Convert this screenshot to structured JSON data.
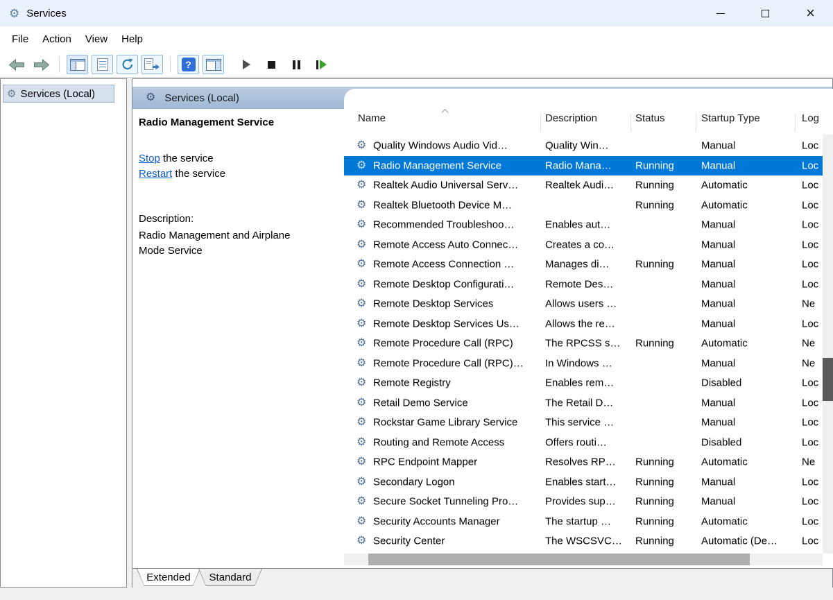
{
  "window": {
    "title": "Services"
  },
  "menu": {
    "items": [
      "File",
      "Action",
      "View",
      "Help"
    ]
  },
  "toolbar": {
    "buttons": [
      "back",
      "forward",
      "show-console-tree",
      "properties",
      "refresh",
      "export-list",
      "help",
      "show-action-pane",
      "start-service",
      "stop-service",
      "pause-service",
      "restart-service"
    ],
    "help_glyph": "?"
  },
  "tree": {
    "root_label": "Services (Local)"
  },
  "main": {
    "banner": "Services (Local)",
    "detail": {
      "service_name": "Radio Management Service",
      "stop_link": "Stop",
      "stop_suffix": " the service",
      "restart_link": "Restart",
      "restart_suffix": " the service",
      "description_label": "Description:",
      "description_text": "Radio Management and Airplane Mode Service"
    },
    "table": {
      "columns": [
        "Name",
        "Description",
        "Status",
        "Startup Type",
        "Log"
      ],
      "rows": [
        {
          "name": "Quality Windows Audio Vid…",
          "description": "Quality Win…",
          "status": "",
          "startup": "Manual",
          "logon": "Loc",
          "selected": false
        },
        {
          "name": "Radio Management Service",
          "description": "Radio Mana…",
          "status": "Running",
          "startup": "Manual",
          "logon": "Loc",
          "selected": true
        },
        {
          "name": "Realtek Audio Universal Serv…",
          "description": "Realtek Audi…",
          "status": "Running",
          "startup": "Automatic",
          "logon": "Loc",
          "selected": false
        },
        {
          "name": "Realtek Bluetooth Device M…",
          "description": "",
          "status": "Running",
          "startup": "Automatic",
          "logon": "Loc",
          "selected": false
        },
        {
          "name": "Recommended Troubleshoo…",
          "description": "Enables aut…",
          "status": "",
          "startup": "Manual",
          "logon": "Loc",
          "selected": false
        },
        {
          "name": "Remote Access Auto Connec…",
          "description": "Creates a co…",
          "status": "",
          "startup": "Manual",
          "logon": "Loc",
          "selected": false
        },
        {
          "name": "Remote Access Connection …",
          "description": "Manages di…",
          "status": "Running",
          "startup": "Manual",
          "logon": "Loc",
          "selected": false
        },
        {
          "name": "Remote Desktop Configurati…",
          "description": "Remote Des…",
          "status": "",
          "startup": "Manual",
          "logon": "Loc",
          "selected": false
        },
        {
          "name": "Remote Desktop Services",
          "description": "Allows users …",
          "status": "",
          "startup": "Manual",
          "logon": "Ne",
          "selected": false
        },
        {
          "name": "Remote Desktop Services Us…",
          "description": "Allows the re…",
          "status": "",
          "startup": "Manual",
          "logon": "Loc",
          "selected": false
        },
        {
          "name": "Remote Procedure Call (RPC)",
          "description": "The RPCSS s…",
          "status": "Running",
          "startup": "Automatic",
          "logon": "Ne",
          "selected": false
        },
        {
          "name": "Remote Procedure Call (RPC)…",
          "description": "In Windows …",
          "status": "",
          "startup": "Manual",
          "logon": "Ne",
          "selected": false
        },
        {
          "name": "Remote Registry",
          "description": "Enables rem…",
          "status": "",
          "startup": "Disabled",
          "logon": "Loc",
          "selected": false
        },
        {
          "name": "Retail Demo Service",
          "description": "The Retail D…",
          "status": "",
          "startup": "Manual",
          "logon": "Loc",
          "selected": false
        },
        {
          "name": "Rockstar Game Library Service",
          "description": "This service …",
          "status": "",
          "startup": "Manual",
          "logon": "Loc",
          "selected": false
        },
        {
          "name": "Routing and Remote Access",
          "description": "Offers routi…",
          "status": "",
          "startup": "Disabled",
          "logon": "Loc",
          "selected": false
        },
        {
          "name": "RPC Endpoint Mapper",
          "description": "Resolves RP…",
          "status": "Running",
          "startup": "Automatic",
          "logon": "Ne",
          "selected": false
        },
        {
          "name": "Secondary Logon",
          "description": "Enables start…",
          "status": "Running",
          "startup": "Manual",
          "logon": "Loc",
          "selected": false
        },
        {
          "name": "Secure Socket Tunneling Pro…",
          "description": "Provides sup…",
          "status": "Running",
          "startup": "Manual",
          "logon": "Loc",
          "selected": false
        },
        {
          "name": "Security Accounts Manager",
          "description": "The startup …",
          "status": "Running",
          "startup": "Automatic",
          "logon": "Loc",
          "selected": false
        },
        {
          "name": "Security Center",
          "description": "The WSCSVC…",
          "status": "Running",
          "startup": "Automatic (De…",
          "logon": "Loc",
          "selected": false
        }
      ]
    }
  },
  "tabs": [
    {
      "label": "Extended",
      "active": true
    },
    {
      "label": "Standard",
      "active": false
    }
  ],
  "colors": {
    "selection_background": "#0078d7",
    "selection_text": "#ffffff",
    "banner_background": "#a9bfd9",
    "titlebar_background": "#e9f1fa",
    "link": "#0b5fcb"
  }
}
